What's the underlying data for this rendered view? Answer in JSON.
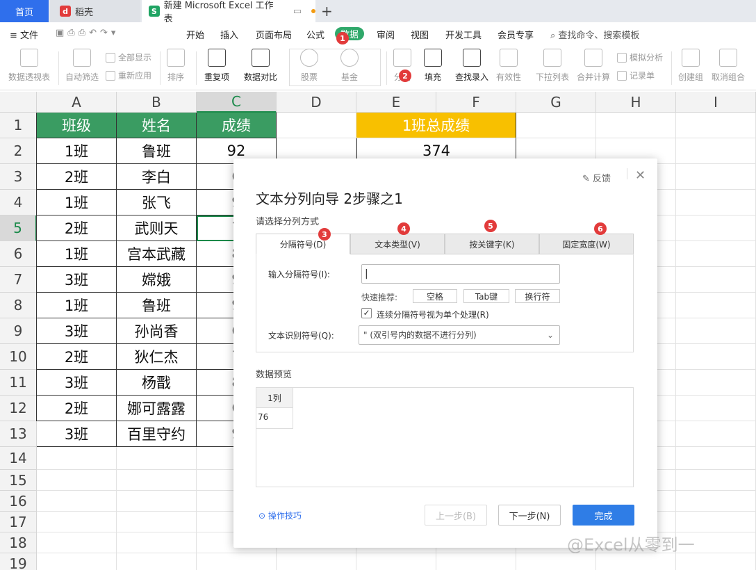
{
  "tabs": {
    "home": "首页",
    "docer": "稻壳",
    "file_title": "新建 Microsoft Excel 工作表"
  },
  "menu": {
    "file": "文件",
    "items": [
      "开始",
      "插入",
      "页面布局",
      "公式",
      "数据",
      "审阅",
      "视图",
      "开发工具",
      "会员专享"
    ],
    "search": "查找命令、搜索模板"
  },
  "ribbon": {
    "pivot": "数据透视表",
    "autofilter": "自动筛选",
    "show_all": "全部显示",
    "reapply": "重新应用",
    "sort": "排序",
    "dup": "重复项",
    "compare": "数据对比",
    "stock": "股票",
    "fund": "基金",
    "split": "分列",
    "fill": "填充",
    "lookup": "查找录入",
    "validity": "有效性",
    "dropdown": "下拉列表",
    "consolidate": "合并计算",
    "simulate": "模拟分析",
    "record": "记录单",
    "group": "创建组",
    "ungroup": "取消组合"
  },
  "columns": [
    "A",
    "B",
    "C",
    "D",
    "E",
    "F",
    "G",
    "H",
    "I"
  ],
  "rows": [
    "1",
    "2",
    "3",
    "4",
    "5",
    "6",
    "7",
    "8",
    "9",
    "10",
    "11",
    "12",
    "13",
    "14",
    "15",
    "16",
    "17",
    "18",
    "19"
  ],
  "table": {
    "headers": [
      "班级",
      "姓名",
      "成绩"
    ],
    "classes": [
      "1班",
      "2班",
      "1班",
      "2班",
      "1班",
      "3班",
      "1班",
      "3班",
      "2班",
      "3班",
      "2班",
      "3班"
    ],
    "names": [
      "鲁班",
      "李白",
      "张飞",
      "武则天",
      "宫本武藏",
      "嫦娥",
      "鲁班",
      "孙尚香",
      "狄仁杰",
      "杨戬",
      "娜可露露",
      "百里守约"
    ],
    "scores": [
      "92",
      "6",
      "9",
      "7",
      "8",
      "9",
      "9",
      "6",
      "7",
      "8",
      "6",
      "9"
    ]
  },
  "summary": {
    "label": "1班总成绩",
    "value": "374"
  },
  "badges": [
    "1",
    "2",
    "3",
    "4",
    "5",
    "6"
  ],
  "dialog": {
    "feedback": "反馈",
    "title": "文本分列向导 2步骤之1",
    "subtitle": "请选择分列方式",
    "tabs": [
      "分隔符号(D)",
      "文本类型(V)",
      "按关键字(K)",
      "固定宽度(W)"
    ],
    "delim_label": "输入分隔符号(I):",
    "quick": "快速推荐:",
    "chips": [
      "空格",
      "Tab键",
      "换行符"
    ],
    "consecutive": "连续分隔符号视为单个处理(R)",
    "qualifier_label": "文本识别符号(Q):",
    "qualifier_value": "\"  (双引号内的数据不进行分列)",
    "preview": "数据预览",
    "preview_col": "1列",
    "preview_val": "76",
    "tips": "操作技巧",
    "prev": "上一步(B)",
    "next": "下一步(N)",
    "finish": "完成"
  },
  "watermark": "@Excel从零到一",
  "colors": {
    "accent": "#2f6fec",
    "header_green": "#3a9c62",
    "orange": "#f8c000",
    "badge": "#e23b3b",
    "active_data": "#2fa86a"
  }
}
